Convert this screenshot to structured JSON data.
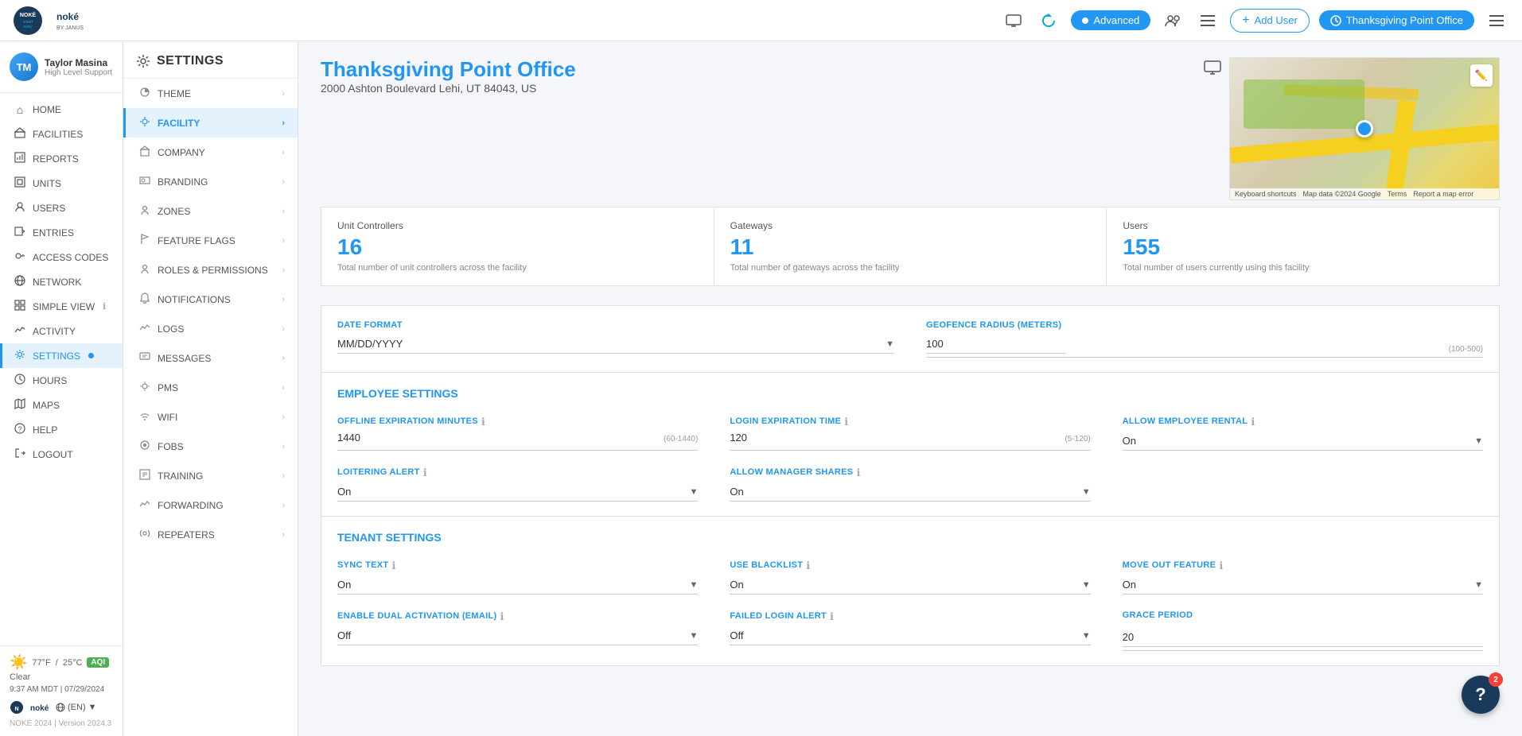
{
  "topnav": {
    "advanced_label": "Advanced",
    "add_user_label": "Add User",
    "facility_label": "Thanksgiving Point Office"
  },
  "sidebar": {
    "user": {
      "name": "Taylor Masina",
      "role": "High Level Support",
      "initials": "TM"
    },
    "nav_items": [
      {
        "id": "home",
        "label": "HOME",
        "icon": "⌂"
      },
      {
        "id": "facilities",
        "label": "FACILITIES",
        "icon": "🏢"
      },
      {
        "id": "reports",
        "label": "REPORTS",
        "icon": "📊"
      },
      {
        "id": "units",
        "label": "UNITS",
        "icon": "◻"
      },
      {
        "id": "users",
        "label": "USERS",
        "icon": "👤"
      },
      {
        "id": "entries",
        "label": "ENTRIES",
        "icon": "🚪"
      },
      {
        "id": "access-codes",
        "label": "ACCESS CODES",
        "icon": "🔑"
      },
      {
        "id": "network",
        "label": "NETWORK",
        "icon": "🌐"
      },
      {
        "id": "simple-view",
        "label": "SIMPLE VIEW",
        "icon": "▦"
      },
      {
        "id": "activity",
        "label": "ACTIVITY",
        "icon": "📈"
      },
      {
        "id": "settings",
        "label": "SETTINGS",
        "icon": "⚙",
        "active": true,
        "dot": true
      },
      {
        "id": "hours",
        "label": "HOURS",
        "icon": "🕐"
      },
      {
        "id": "maps",
        "label": "MAPS",
        "icon": "🗺"
      },
      {
        "id": "help",
        "label": "HELP",
        "icon": "❓"
      },
      {
        "id": "logout",
        "label": "LOGOUT",
        "icon": "↩"
      }
    ],
    "weather": {
      "temp_f": "77°F",
      "temp_c": "25°C",
      "condition": "Clear",
      "icon": "☀️",
      "aqi": "AQI"
    },
    "datetime": "9:37 AM MDT | 07/29/2024",
    "version": "NOKÉ 2024 | Version 2024.3",
    "language": "(EN)"
  },
  "settings_menu": {
    "title": "SETTINGS",
    "items": [
      {
        "id": "theme",
        "label": "THEME",
        "icon": "🎨"
      },
      {
        "id": "facility",
        "label": "FACILITY",
        "icon": "⚙",
        "active": true
      },
      {
        "id": "company",
        "label": "COMPANY",
        "icon": "🏢"
      },
      {
        "id": "branding",
        "label": "BRANDING",
        "icon": "🖼"
      },
      {
        "id": "zones",
        "label": "ZONES",
        "icon": "👤"
      },
      {
        "id": "feature-flags",
        "label": "FEATURE FLAGS",
        "icon": "⚑"
      },
      {
        "id": "roles-permissions",
        "label": "ROLES & PERMISSIONS",
        "icon": "👤"
      },
      {
        "id": "notifications",
        "label": "NOTIFICATIONS",
        "icon": "🔔"
      },
      {
        "id": "logs",
        "label": "LOGS",
        "icon": "📈"
      },
      {
        "id": "messages",
        "label": "MESSAGES",
        "icon": "✉"
      },
      {
        "id": "pms",
        "label": "PMS",
        "icon": "⚙"
      },
      {
        "id": "wifi",
        "label": "WIFI",
        "icon": "📶"
      },
      {
        "id": "fobs",
        "label": "FOBS",
        "icon": "⊙"
      },
      {
        "id": "training",
        "label": "TRAINING",
        "icon": "📋"
      },
      {
        "id": "forwarding",
        "label": "FORWARDING",
        "icon": "📈"
      },
      {
        "id": "repeaters",
        "label": "REPEATERS",
        "icon": "📡"
      }
    ]
  },
  "facility": {
    "title": "Thanksgiving Point Office",
    "address": "2000 Ashton Boulevard Lehi, UT 84043, US",
    "stats": {
      "unit_controllers": {
        "label": "Unit Controllers",
        "value": "16",
        "desc": "Total number of unit controllers across the facility"
      },
      "gateways": {
        "label": "Gateways",
        "value": "11",
        "desc": "Total number of gateways across the facility"
      },
      "users": {
        "label": "Users",
        "value": "155",
        "desc": "Total number of users currently using this facility"
      }
    },
    "date_format": {
      "label": "Date Format",
      "value": "MM/DD/YYYY"
    },
    "geofence_radius": {
      "label": "Geofence Radius (Meters)",
      "value": "100",
      "hint": "(100-500)"
    },
    "employee_settings": {
      "section_title": "EMPLOYEE SETTINGS",
      "offline_expiration": {
        "label": "Offline Expiration Minutes",
        "value": "1440",
        "hint": "(60-1440)"
      },
      "login_expiration": {
        "label": "Login Expiration Time",
        "value": "120",
        "hint": "(5-120)"
      },
      "allow_employee_rental": {
        "label": "Allow Employee Rental",
        "value": "On"
      },
      "loitering_alert": {
        "label": "Loitering Alert",
        "value": "On"
      },
      "allow_manager_shares": {
        "label": "Allow Manager Shares",
        "value": "On"
      }
    },
    "tenant_settings": {
      "section_title": "TENANT SETTINGS",
      "sync_text": {
        "label": "Sync Text",
        "value": "On"
      },
      "use_blacklist": {
        "label": "Use Blacklist",
        "value": "On"
      },
      "move_out_feature": {
        "label": "Move Out Feature",
        "value": "On"
      },
      "enable_dual_activation": {
        "label": "Enable Dual Activation (Email)",
        "value": "Off"
      },
      "failed_login_alert": {
        "label": "Failed Login Alert",
        "value": "Off"
      },
      "grace_period": {
        "label": "Grace Period",
        "value": "20"
      }
    }
  },
  "help_fab": {
    "icon": "?",
    "notification_count": "2"
  }
}
